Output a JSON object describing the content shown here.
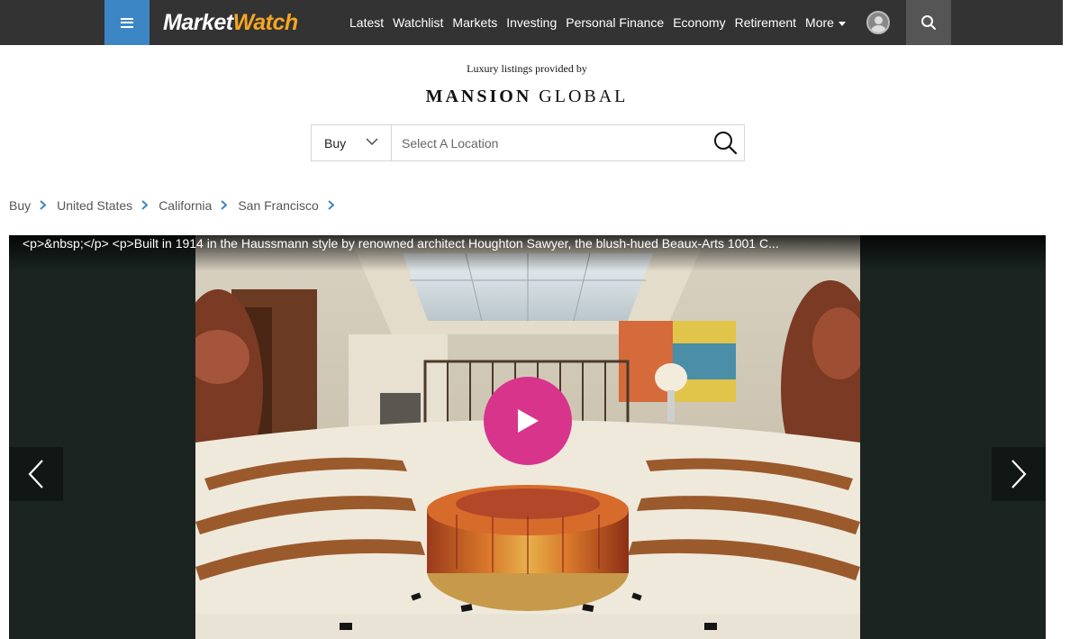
{
  "header": {
    "logo_market": "Market",
    "logo_watch": "Watch",
    "nav": [
      "Latest",
      "Watchlist",
      "Markets",
      "Investing",
      "Personal Finance",
      "Economy",
      "Retirement"
    ],
    "more_label": "More"
  },
  "partner": {
    "provided_by": "Luxury listings provided by",
    "brand_bold": "MANSION",
    "brand_rest": " GLOBAL"
  },
  "search": {
    "mode": "Buy",
    "location_placeholder": "Select A Location"
  },
  "breadcrumb": [
    "Buy",
    "United States",
    "California",
    "San Francisco"
  ],
  "gallery": {
    "caption": "<p>&nbsp;</p> <p>Built in 1914 in the Haussmann style by renowned architect Houghton Sawyer, the blush-hued Beaux-Arts 1001 C..."
  },
  "colors": {
    "topbar": "#333333",
    "menu_accent": "#3d86c6",
    "play_button": "#d8348c",
    "chevron": "#3d86c6"
  },
  "icons": {
    "menu": "hamburger-icon",
    "user": "user-avatar-icon",
    "search": "magnifier-icon",
    "dropdown": "chevron-down-icon",
    "play": "play-icon",
    "prev": "chevron-left-icon",
    "next": "chevron-right-icon"
  }
}
